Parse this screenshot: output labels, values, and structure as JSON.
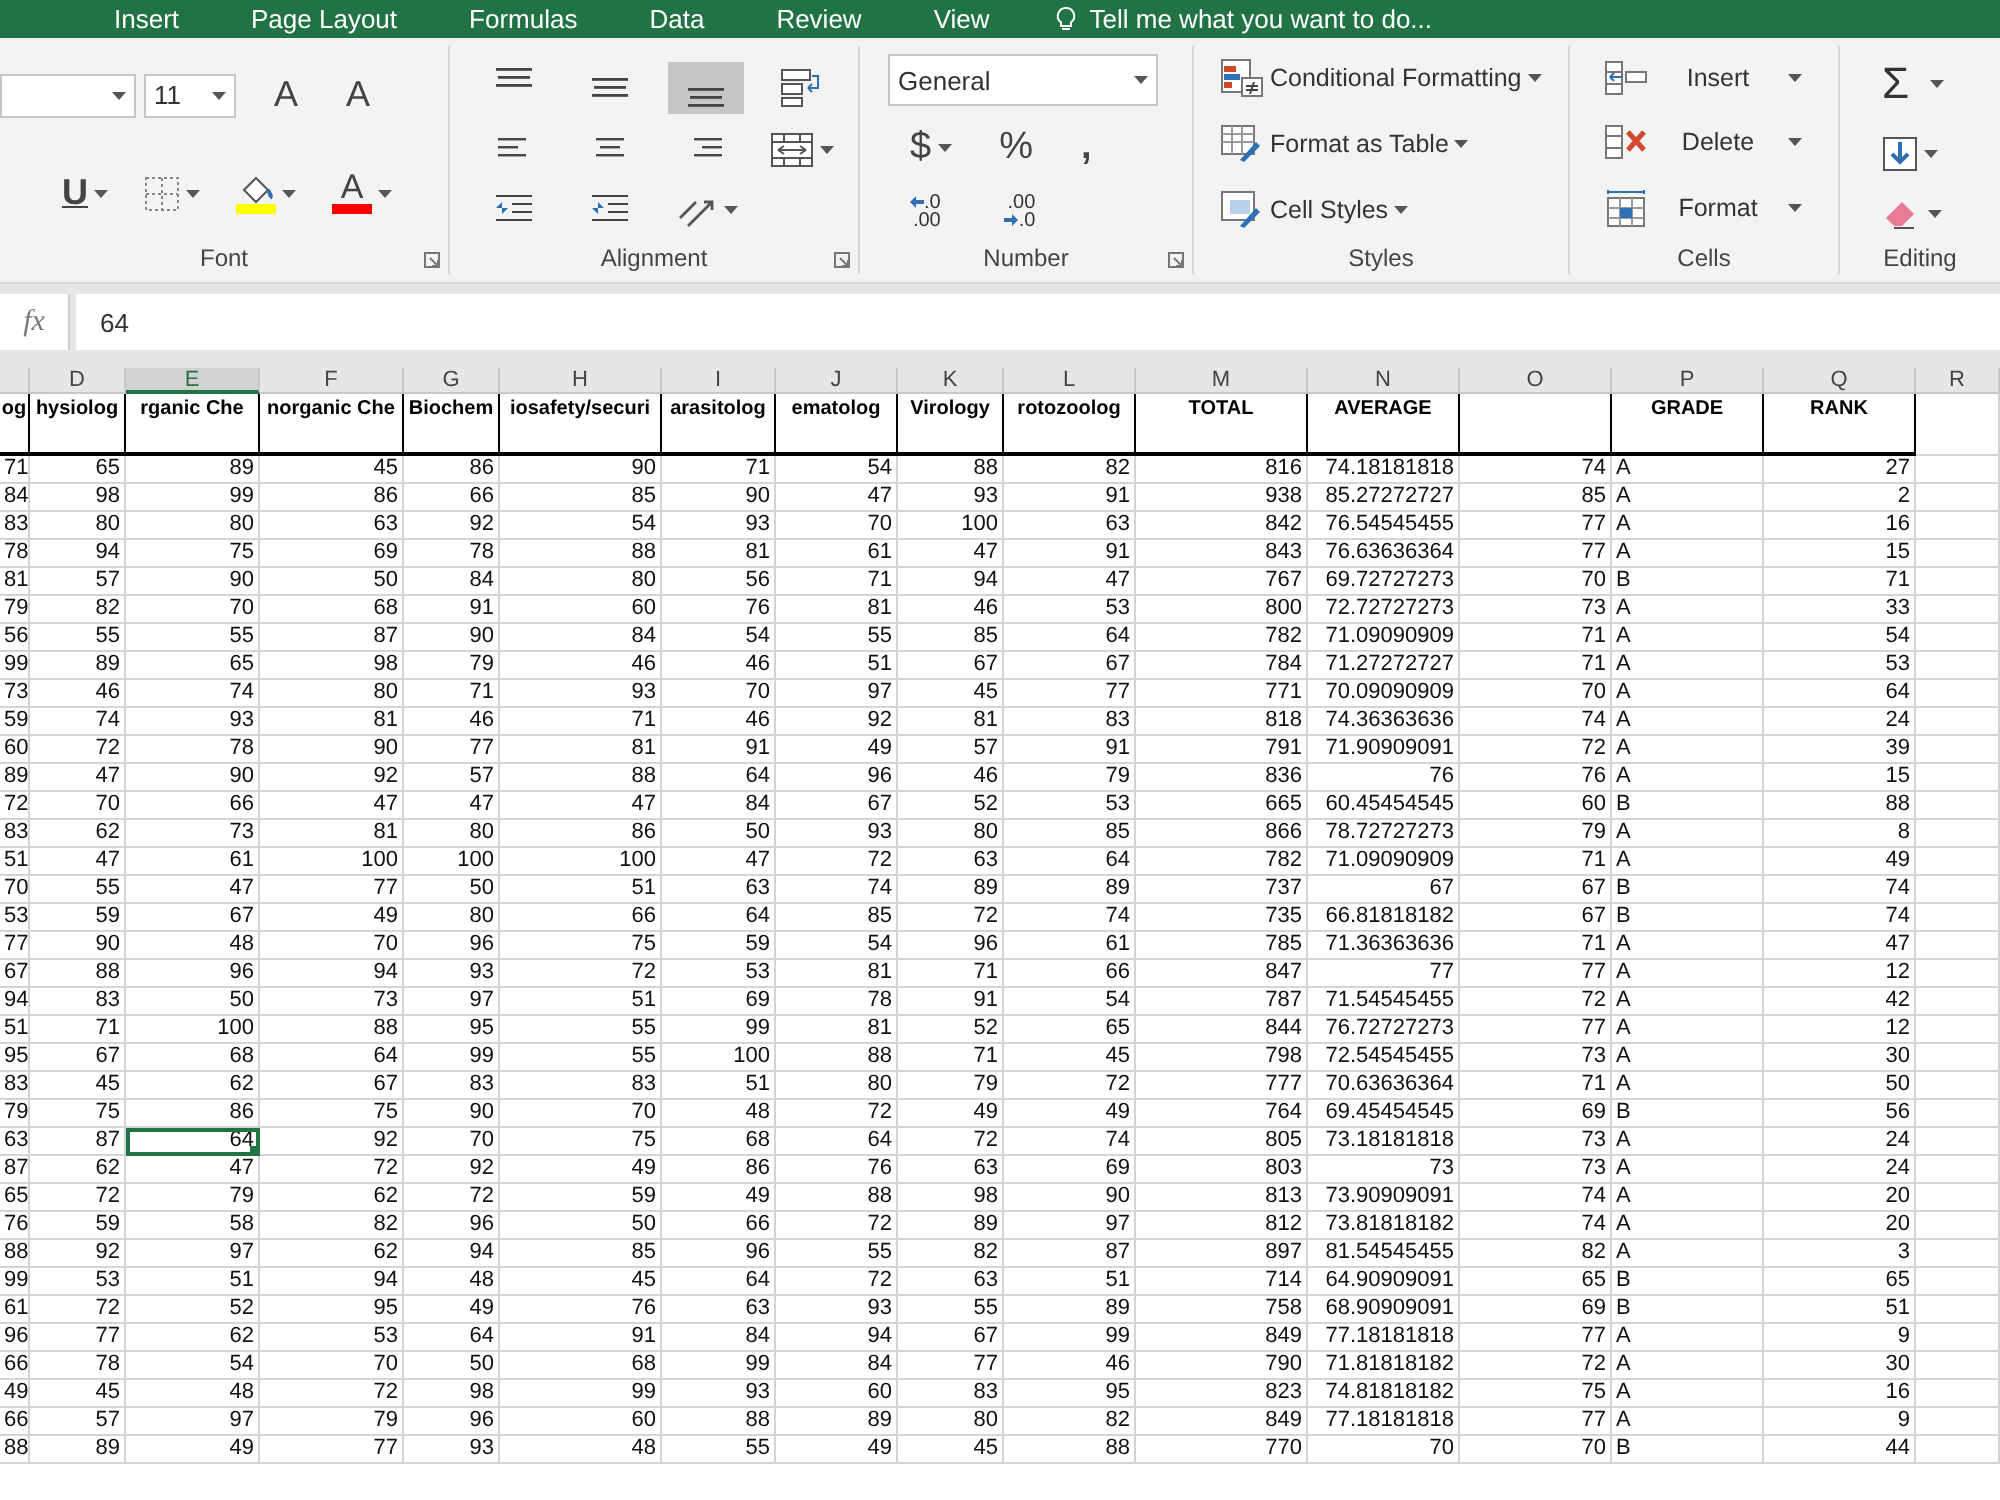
{
  "ribbon_tabs": [
    "Insert",
    "Page Layout",
    "Formulas",
    "Data",
    "Review",
    "View"
  ],
  "tell_me": "Tell me what you want to do...",
  "font_group": {
    "label": "Font",
    "font_size": "11",
    "grow_font": "A",
    "shrink_font": "A",
    "underline": "U",
    "font_color": "A"
  },
  "alignment_group": {
    "label": "Alignment",
    "vertical_align": [
      {
        "kind": "top",
        "selected": false
      },
      {
        "kind": "middle",
        "selected": false
      },
      {
        "kind": "bottom",
        "selected": true
      }
    ]
  },
  "number_group": {
    "label": "Number",
    "format": "General",
    "currency": "$",
    "percent": "%",
    "comma": ",",
    "increase_decimal": [
      ".0",
      ".00"
    ],
    "decrease_decimal": [
      ".00",
      ".0"
    ]
  },
  "styles_group": {
    "label": "Styles",
    "items": [
      {
        "kind": "conditional",
        "label": "Conditional Formatting"
      },
      {
        "kind": "table",
        "label": "Format as Table"
      },
      {
        "kind": "cellstyles",
        "label": "Cell Styles"
      }
    ]
  },
  "cells_group": {
    "label": "Cells",
    "items": [
      {
        "kind": "insert",
        "label": "Insert"
      },
      {
        "kind": "delete",
        "label": "Delete"
      },
      {
        "kind": "format",
        "label": "Format"
      }
    ]
  },
  "editing_group": {
    "label": "Editing",
    "autosum": "Σ"
  },
  "formula_bar": {
    "fx": "fx",
    "value": "64"
  },
  "sheet": {
    "columns": [
      {
        "header": "og",
        "kind": "number",
        "selected": false
      },
      {
        "letter": "D",
        "header": "hysiolog",
        "kind": "number",
        "selected": false
      },
      {
        "letter": "E",
        "header": "rganic Che",
        "kind": "number",
        "selected": true
      },
      {
        "letter": "F",
        "header": "norganic Che",
        "kind": "number",
        "selected": false
      },
      {
        "letter": "G",
        "header": "Biochem",
        "kind": "number",
        "selected": false
      },
      {
        "letter": "H",
        "header": "iosafety/securi",
        "kind": "number",
        "selected": false
      },
      {
        "letter": "I",
        "header": "arasitolog",
        "kind": "number",
        "selected": false
      },
      {
        "letter": "J",
        "header": "ematolog",
        "kind": "number",
        "selected": false
      },
      {
        "letter": "K",
        "header": "Virology",
        "kind": "number",
        "selected": false
      },
      {
        "letter": "L",
        "header": "rotozoolog",
        "kind": "number",
        "selected": false
      },
      {
        "letter": "M",
        "header": "TOTAL",
        "kind": "number",
        "selected": false
      },
      {
        "letter": "N",
        "header": "AVERAGE",
        "kind": "number",
        "selected": false
      },
      {
        "letter": "O",
        "kind": "number",
        "selected": false
      },
      {
        "letter": "P",
        "header": "GRADE",
        "kind": "text",
        "selected": false
      },
      {
        "letter": "Q",
        "header": "RANK",
        "kind": "number",
        "selected": false
      },
      {
        "letter": "R",
        "kind": "number",
        "selected": false
      }
    ],
    "rows": [
      {
        "selected": false,
        "cells": [
          "71",
          "65",
          "89",
          "45",
          "86",
          "90",
          "71",
          "54",
          "88",
          "82",
          "816",
          "74.18181818",
          "74",
          "A",
          "27"
        ]
      },
      {
        "selected": false,
        "cells": [
          "84",
          "98",
          "99",
          "86",
          "66",
          "85",
          "90",
          "47",
          "93",
          "91",
          "938",
          "85.27272727",
          "85",
          "A",
          "2"
        ]
      },
      {
        "selected": false,
        "cells": [
          "83",
          "80",
          "80",
          "63",
          "92",
          "54",
          "93",
          "70",
          "100",
          "63",
          "842",
          "76.54545455",
          "77",
          "A",
          "16"
        ]
      },
      {
        "selected": false,
        "cells": [
          "78",
          "94",
          "75",
          "69",
          "78",
          "88",
          "81",
          "61",
          "47",
          "91",
          "843",
          "76.63636364",
          "77",
          "A",
          "15"
        ]
      },
      {
        "selected": false,
        "cells": [
          "81",
          "57",
          "90",
          "50",
          "84",
          "80",
          "56",
          "71",
          "94",
          "47",
          "767",
          "69.72727273",
          "70",
          "B",
          "71"
        ]
      },
      {
        "selected": false,
        "cells": [
          "79",
          "82",
          "70",
          "68",
          "91",
          "60",
          "76",
          "81",
          "46",
          "53",
          "800",
          "72.72727273",
          "73",
          "A",
          "33"
        ]
      },
      {
        "selected": false,
        "cells": [
          "56",
          "55",
          "55",
          "87",
          "90",
          "84",
          "54",
          "55",
          "85",
          "64",
          "782",
          "71.09090909",
          "71",
          "A",
          "54"
        ]
      },
      {
        "selected": false,
        "cells": [
          "99",
          "89",
          "65",
          "98",
          "79",
          "46",
          "46",
          "51",
          "67",
          "67",
          "784",
          "71.27272727",
          "71",
          "A",
          "53"
        ]
      },
      {
        "selected": false,
        "cells": [
          "73",
          "46",
          "74",
          "80",
          "71",
          "93",
          "70",
          "97",
          "45",
          "77",
          "771",
          "70.09090909",
          "70",
          "A",
          "64"
        ]
      },
      {
        "selected": false,
        "cells": [
          "59",
          "74",
          "93",
          "81",
          "46",
          "71",
          "46",
          "92",
          "81",
          "83",
          "818",
          "74.36363636",
          "74",
          "A",
          "24"
        ]
      },
      {
        "selected": false,
        "cells": [
          "60",
          "72",
          "78",
          "90",
          "77",
          "81",
          "91",
          "49",
          "57",
          "91",
          "791",
          "71.90909091",
          "72",
          "A",
          "39"
        ]
      },
      {
        "selected": false,
        "cells": [
          "89",
          "47",
          "90",
          "92",
          "57",
          "88",
          "64",
          "96",
          "46",
          "79",
          "836",
          "76",
          "76",
          "A",
          "15"
        ]
      },
      {
        "selected": false,
        "cells": [
          "72",
          "70",
          "66",
          "47",
          "47",
          "47",
          "84",
          "67",
          "52",
          "53",
          "665",
          "60.45454545",
          "60",
          "B",
          "88"
        ]
      },
      {
        "selected": false,
        "cells": [
          "83",
          "62",
          "73",
          "81",
          "80",
          "86",
          "50",
          "93",
          "80",
          "85",
          "866",
          "78.72727273",
          "79",
          "A",
          "8"
        ]
      },
      {
        "selected": false,
        "cells": [
          "51",
          "47",
          "61",
          "100",
          "100",
          "100",
          "47",
          "72",
          "63",
          "64",
          "782",
          "71.09090909",
          "71",
          "A",
          "49"
        ]
      },
      {
        "selected": false,
        "cells": [
          "70",
          "55",
          "47",
          "77",
          "50",
          "51",
          "63",
          "74",
          "89",
          "89",
          "737",
          "67",
          "67",
          "B",
          "74"
        ]
      },
      {
        "selected": false,
        "cells": [
          "53",
          "59",
          "67",
          "49",
          "80",
          "66",
          "64",
          "85",
          "72",
          "74",
          "735",
          "66.81818182",
          "67",
          "B",
          "74"
        ]
      },
      {
        "selected": false,
        "cells": [
          "77",
          "90",
          "48",
          "70",
          "96",
          "75",
          "59",
          "54",
          "96",
          "61",
          "785",
          "71.36363636",
          "71",
          "A",
          "47"
        ]
      },
      {
        "selected": false,
        "cells": [
          "67",
          "88",
          "96",
          "94",
          "93",
          "72",
          "53",
          "81",
          "71",
          "66",
          "847",
          "77",
          "77",
          "A",
          "12"
        ]
      },
      {
        "selected": false,
        "cells": [
          "94",
          "83",
          "50",
          "73",
          "97",
          "51",
          "69",
          "78",
          "91",
          "54",
          "787",
          "71.54545455",
          "72",
          "A",
          "42"
        ]
      },
      {
        "selected": false,
        "cells": [
          "51",
          "71",
          "100",
          "88",
          "95",
          "55",
          "99",
          "81",
          "52",
          "65",
          "844",
          "76.72727273",
          "77",
          "A",
          "12"
        ]
      },
      {
        "selected": false,
        "cells": [
          "95",
          "67",
          "68",
          "64",
          "99",
          "55",
          "100",
          "88",
          "71",
          "45",
          "798",
          "72.54545455",
          "73",
          "A",
          "30"
        ]
      },
      {
        "selected": false,
        "cells": [
          "83",
          "45",
          "62",
          "67",
          "83",
          "83",
          "51",
          "80",
          "79",
          "72",
          "777",
          "70.63636364",
          "71",
          "A",
          "50"
        ]
      },
      {
        "selected": false,
        "cells": [
          "79",
          "75",
          "86",
          "75",
          "90",
          "70",
          "48",
          "72",
          "49",
          "49",
          "764",
          "69.45454545",
          "69",
          "B",
          "56"
        ]
      },
      {
        "selected": true,
        "cells": [
          "63",
          "87",
          "64",
          "92",
          "70",
          "75",
          "68",
          "64",
          "72",
          "74",
          "805",
          "73.18181818",
          "73",
          "A",
          "24"
        ]
      },
      {
        "selected": false,
        "cells": [
          "87",
          "62",
          "47",
          "72",
          "92",
          "49",
          "86",
          "76",
          "63",
          "69",
          "803",
          "73",
          "73",
          "A",
          "24"
        ]
      },
      {
        "selected": false,
        "cells": [
          "65",
          "72",
          "79",
          "62",
          "72",
          "59",
          "49",
          "88",
          "98",
          "90",
          "813",
          "73.90909091",
          "74",
          "A",
          "20"
        ]
      },
      {
        "selected": false,
        "cells": [
          "76",
          "59",
          "58",
          "82",
          "96",
          "50",
          "66",
          "72",
          "89",
          "97",
          "812",
          "73.81818182",
          "74",
          "A",
          "20"
        ]
      },
      {
        "selected": false,
        "cells": [
          "88",
          "92",
          "97",
          "62",
          "94",
          "85",
          "96",
          "55",
          "82",
          "87",
          "897",
          "81.54545455",
          "82",
          "A",
          "3"
        ]
      },
      {
        "selected": false,
        "cells": [
          "99",
          "53",
          "51",
          "94",
          "48",
          "45",
          "64",
          "72",
          "63",
          "51",
          "714",
          "64.90909091",
          "65",
          "B",
          "65"
        ]
      },
      {
        "selected": false,
        "cells": [
          "61",
          "72",
          "52",
          "95",
          "49",
          "76",
          "63",
          "93",
          "55",
          "89",
          "758",
          "68.90909091",
          "69",
          "B",
          "51"
        ]
      },
      {
        "selected": false,
        "cells": [
          "96",
          "77",
          "62",
          "53",
          "64",
          "91",
          "84",
          "94",
          "67",
          "99",
          "849",
          "77.18181818",
          "77",
          "A",
          "9"
        ]
      },
      {
        "selected": false,
        "cells": [
          "66",
          "78",
          "54",
          "70",
          "50",
          "68",
          "99",
          "84",
          "77",
          "46",
          "790",
          "71.81818182",
          "72",
          "A",
          "30"
        ]
      },
      {
        "selected": false,
        "cells": [
          "49",
          "45",
          "48",
          "72",
          "98",
          "99",
          "93",
          "60",
          "83",
          "95",
          "823",
          "74.81818182",
          "75",
          "A",
          "16"
        ]
      },
      {
        "selected": false,
        "cells": [
          "66",
          "57",
          "97",
          "79",
          "96",
          "60",
          "88",
          "89",
          "80",
          "82",
          "849",
          "77.18181818",
          "77",
          "A",
          "9"
        ]
      },
      {
        "selected": false,
        "cells": [
          "88",
          "89",
          "49",
          "77",
          "93",
          "48",
          "55",
          "49",
          "45",
          "88",
          "770",
          "70",
          "70",
          "B",
          "44"
        ]
      }
    ]
  }
}
